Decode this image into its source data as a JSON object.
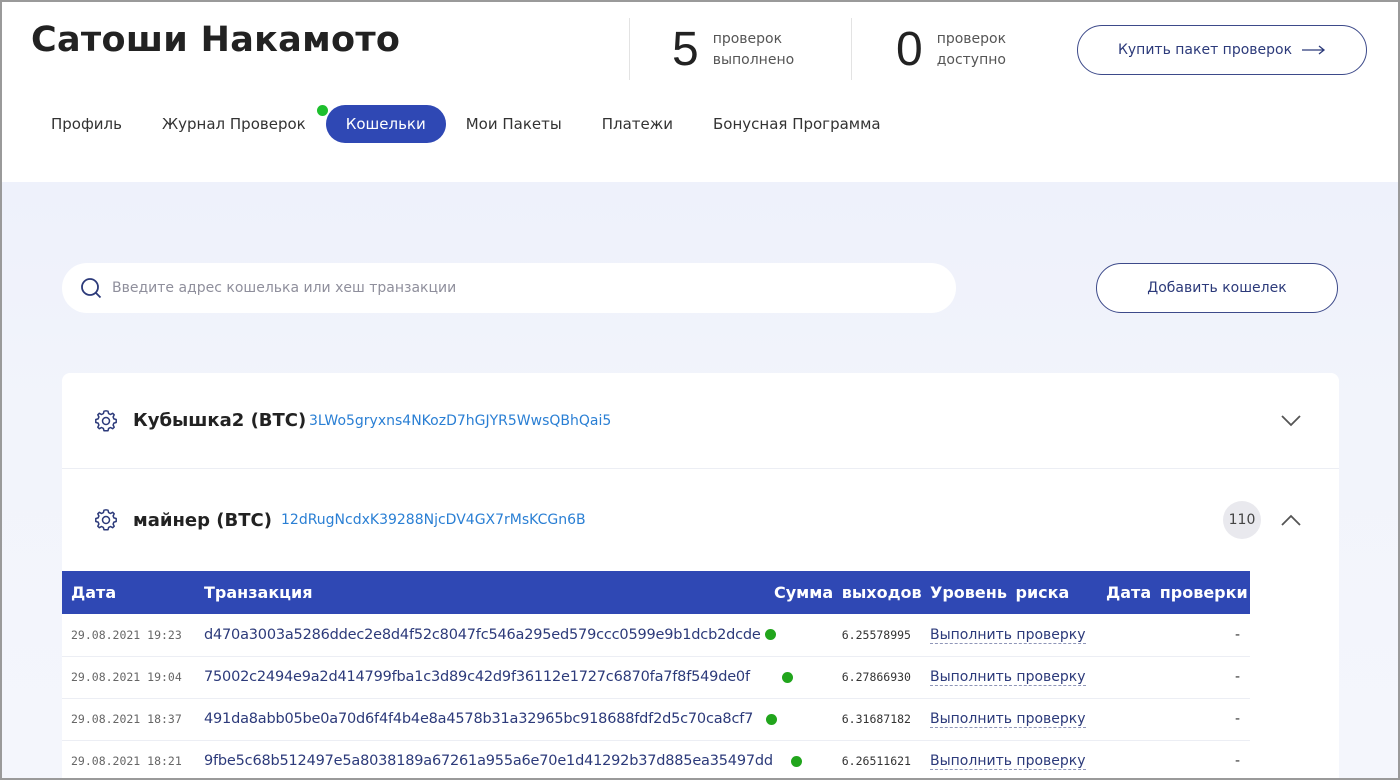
{
  "header": {
    "user_name": "Сатоши Накамото",
    "stats": [
      {
        "value": "5",
        "line1": "проверок",
        "line2": "выполнено"
      },
      {
        "value": "0",
        "line1": "проверок",
        "line2": "доступно"
      }
    ],
    "buy_button": "Купить пакет проверок",
    "nav": [
      {
        "label": "Профиль"
      },
      {
        "label": "Журнал Проверок",
        "has_dot": true
      },
      {
        "label": "Кошельки",
        "active": true
      },
      {
        "label": "Мои Пакеты"
      },
      {
        "label": "Платежи"
      },
      {
        "label": "Бонусная Программа"
      }
    ]
  },
  "search": {
    "placeholder": "Введите адрес кошелька или хеш транзакции",
    "value": ""
  },
  "add_wallet_button": "Добавить кошелек",
  "wallets": [
    {
      "name": "Кубышка2 (BTC)",
      "address": "3LWo5gryxns4NKozD7hGJYR5WwsQBhQai5",
      "expanded": false
    },
    {
      "name": "майнер (BTC)",
      "address": "12dRugNcdxK39288NjcDV4GX7rMsKCGn6B",
      "count": "110",
      "expanded": true
    }
  ],
  "table": {
    "headers": {
      "date": "Дата",
      "tx": "Транзакция",
      "sum": "Сумма выходов",
      "risk": "Уровень риска",
      "checked": "Дата проверки"
    },
    "rows": [
      {
        "date": "29.08.2021 19:23",
        "hash": "d470a3003a5286ddec2e8d4f52c8047fc546a295ed579ccc0599e9b1dcb2dcde",
        "sum": "6.25578995",
        "risk": "Выполнить проверку",
        "checked": "-"
      },
      {
        "date": "29.08.2021 19:04",
        "hash": "75002c2494e9a2d414799fba1c3d89c42d9f36112e1727c6870fa7f8f549de0f",
        "sum": "6.27866930",
        "risk": "Выполнить проверку",
        "checked": "-"
      },
      {
        "date": "29.08.2021 18:37",
        "hash": "491da8abb05be0a70d6f4f4b4e8a4578b31a32965bc918688fdf2d5c70ca8cf7",
        "sum": "6.31687182",
        "risk": "Выполнить проверку",
        "checked": "-"
      },
      {
        "date": "29.08.2021 18:21",
        "hash": "9fbe5c68b512497e5a8038189a67261a955a6e70e1d41292b37d885ea35497dd",
        "sum": "6.26511621",
        "risk": "Выполнить проверку",
        "checked": "-"
      }
    ]
  },
  "colors": {
    "accent": "#2f48b4",
    "link": "#2a7fd4",
    "status_dot": "#21a51c",
    "nav_dot": "#1dbf2d"
  }
}
